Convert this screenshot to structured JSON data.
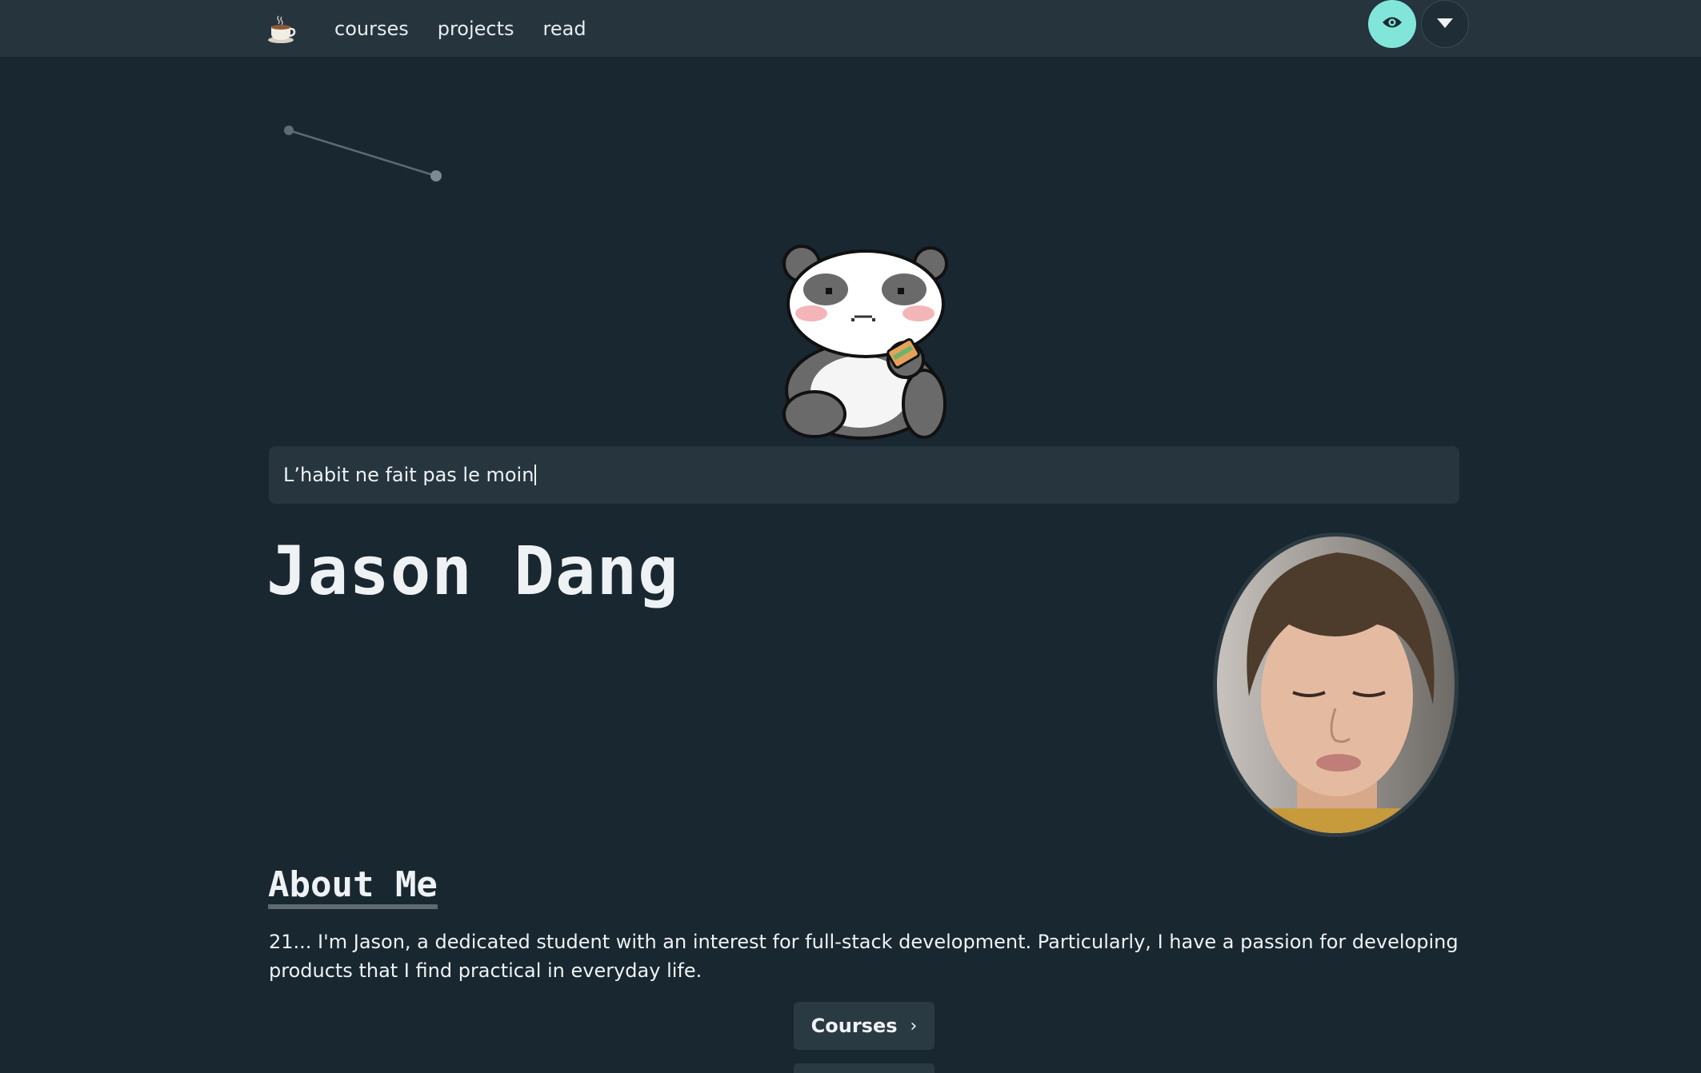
{
  "nav": {
    "logo_icon": "coffee-cup-icon",
    "links": [
      "courses",
      "projects",
      "read"
    ],
    "theme_toggle_icon": "eye-icon",
    "menu_icon": "triangle-down-icon",
    "accent_color": "#81e6d9"
  },
  "hero": {
    "illustration": "panda-eating-sandwich",
    "quote": "L’habit ne fait pas le moin"
  },
  "profile": {
    "name": "Jason Dang",
    "avatar": "profile-photo"
  },
  "about": {
    "heading": "About Me",
    "text": "21... I'm Jason, a dedicated student with an interest for full-stack development. Particularly, I have a passion for developing products that I find practical in everyday life."
  },
  "actions": {
    "courses_label": "Courses",
    "courses_icon": "chevron-right-icon"
  },
  "colors": {
    "background": "#182730",
    "navbar": "#25343d",
    "panel": "#26353e"
  }
}
